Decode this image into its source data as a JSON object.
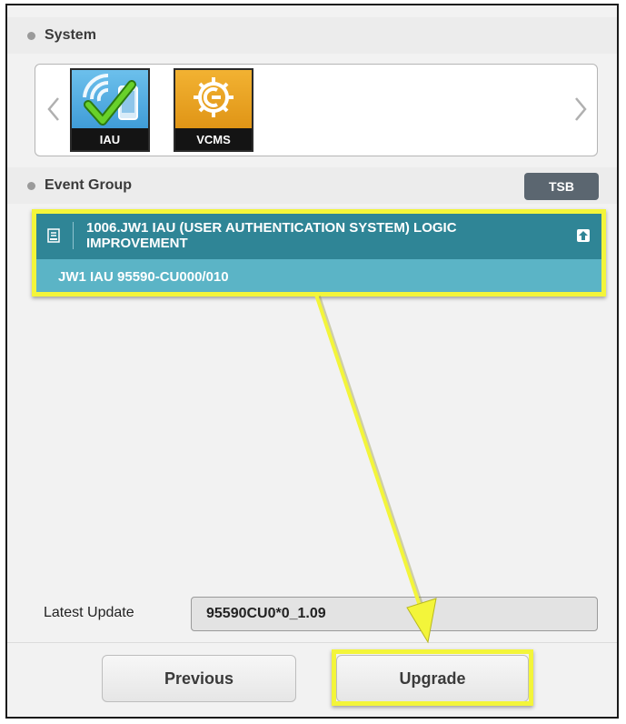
{
  "system": {
    "title": "System",
    "tiles": [
      {
        "label": "IAU",
        "icon": "iau-check-icon",
        "color": "#3f9fd8"
      },
      {
        "label": "VCMS",
        "icon": "vcms-plug-icon",
        "color": "#e39a12"
      }
    ],
    "prev_icon": "chevron-left-icon",
    "next_icon": "chevron-right-icon"
  },
  "event_group": {
    "title": "Event Group",
    "tsb_label": "TSB",
    "item": {
      "title": "1006.JW1 IAU (USER AUTHENTICATION SYSTEM) LOGIC IMPROVEMENT",
      "subtitle": "JW1 IAU 95590-CU000/010"
    }
  },
  "latest_update": {
    "label": "Latest Update",
    "value": "95590CU0*0_1.09"
  },
  "buttons": {
    "previous": "Previous",
    "upgrade": "Upgrade"
  },
  "colors": {
    "highlight": "#f3f53a",
    "event_title_bg": "#2f8596",
    "event_sub_bg": "#5bb4c6",
    "tsb_bg": "#5b6670"
  }
}
